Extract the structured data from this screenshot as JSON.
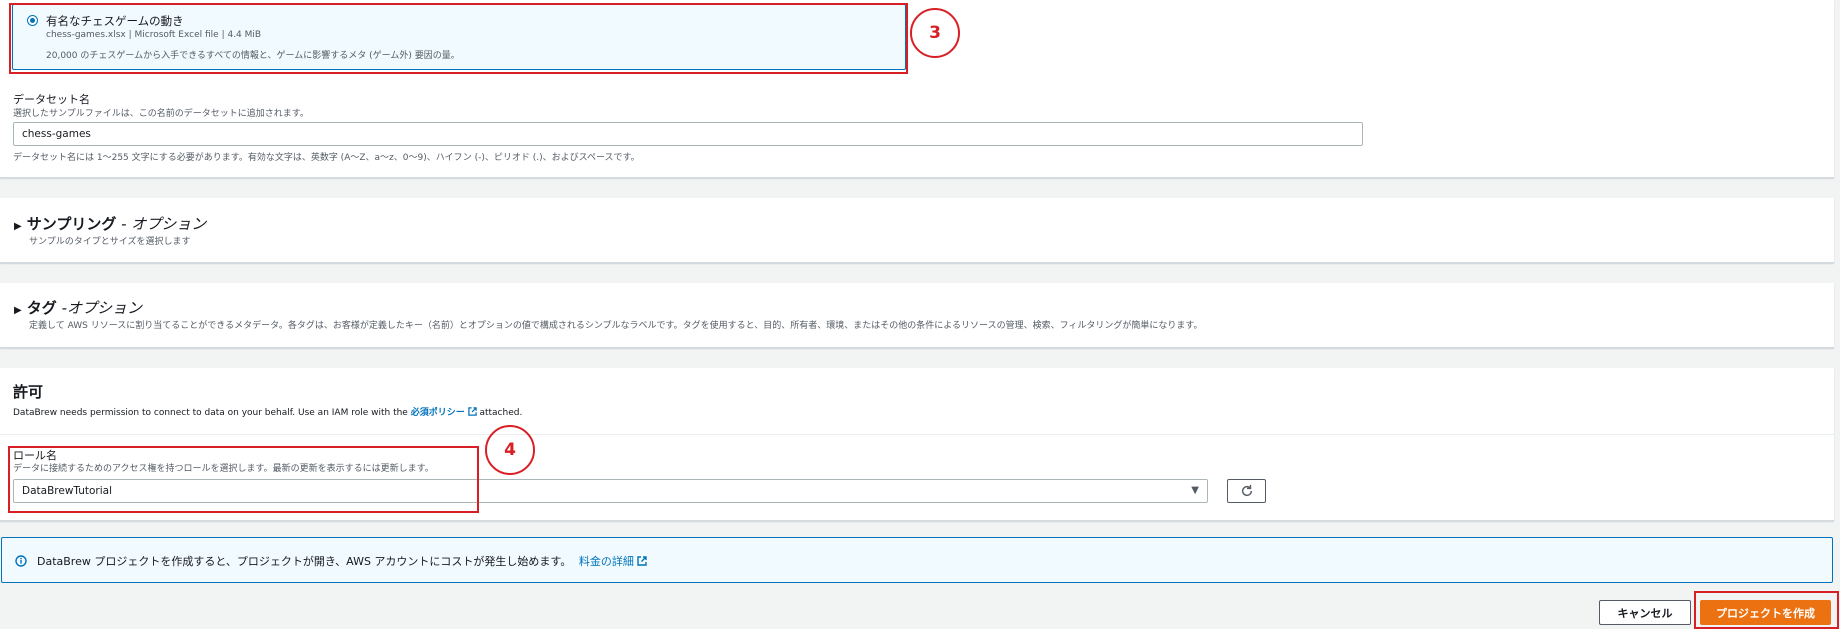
{
  "dataset_sample": {
    "title": "有名なチェスゲームの動き",
    "meta": "chess-games.xlsx | Microsoft Excel file | 4.4 MiB",
    "description": "20,000 のチェスゲームから入手できるすべての情報と、ゲームに影響するメタ (ゲーム外) 要因の量。"
  },
  "dataset_name": {
    "label": "データセット名",
    "description": "選択したサンプルファイルは、この名前のデータセットに追加されます。",
    "value": "chess-games",
    "constraint": "データセット名には 1〜255 文字にする必要があります。有効な文字は、英数字 (A〜Z、a〜z、0〜9)、ハイフン (-)、ピリオド (.)、およびスペースです。"
  },
  "sampling": {
    "title": "サンプリング",
    "title_suffix": " - オプション",
    "description": "サンプルのタイプとサイズを選択します"
  },
  "tags": {
    "title": "タグ",
    "title_suffix": " -オプション",
    "description": "定義して AWS リソースに割り当てることができるメタデータ。各タグは、お客様が定義したキー（名前）とオプションの値で構成されるシンプルなラベルです。タグを使用すると、目的、所有者、環境、またはその他の条件によるリソースの管理、検索、フィルタリングが簡単になります。"
  },
  "permissions": {
    "title": "許可",
    "desc_prefix": "DataBrew needs permission to connect to data on your behalf. Use an IAM role with the ",
    "policy_link": "必須ポリシー",
    "desc_suffix": " attached.",
    "role_label": "ロール名",
    "role_description": "データに接続するためのアクセス権を持つロールを選択します。最新の更新を表示するには更新します。",
    "role_value": "DataBrewTutorial"
  },
  "info_banner": {
    "text": "DataBrew プロジェクトを作成すると、プロジェクトが開き、AWS アカウントにコストが発生し始めます。",
    "link": "料金の詳細"
  },
  "buttons": {
    "cancel": "キャンセル",
    "create": "プロジェクトを作成"
  },
  "annotations": {
    "step3": "3",
    "step4": "4"
  },
  "colors": {
    "accent": "#0073bb",
    "primary_button": "#ec7211",
    "annotation_red": "#d91f26"
  }
}
